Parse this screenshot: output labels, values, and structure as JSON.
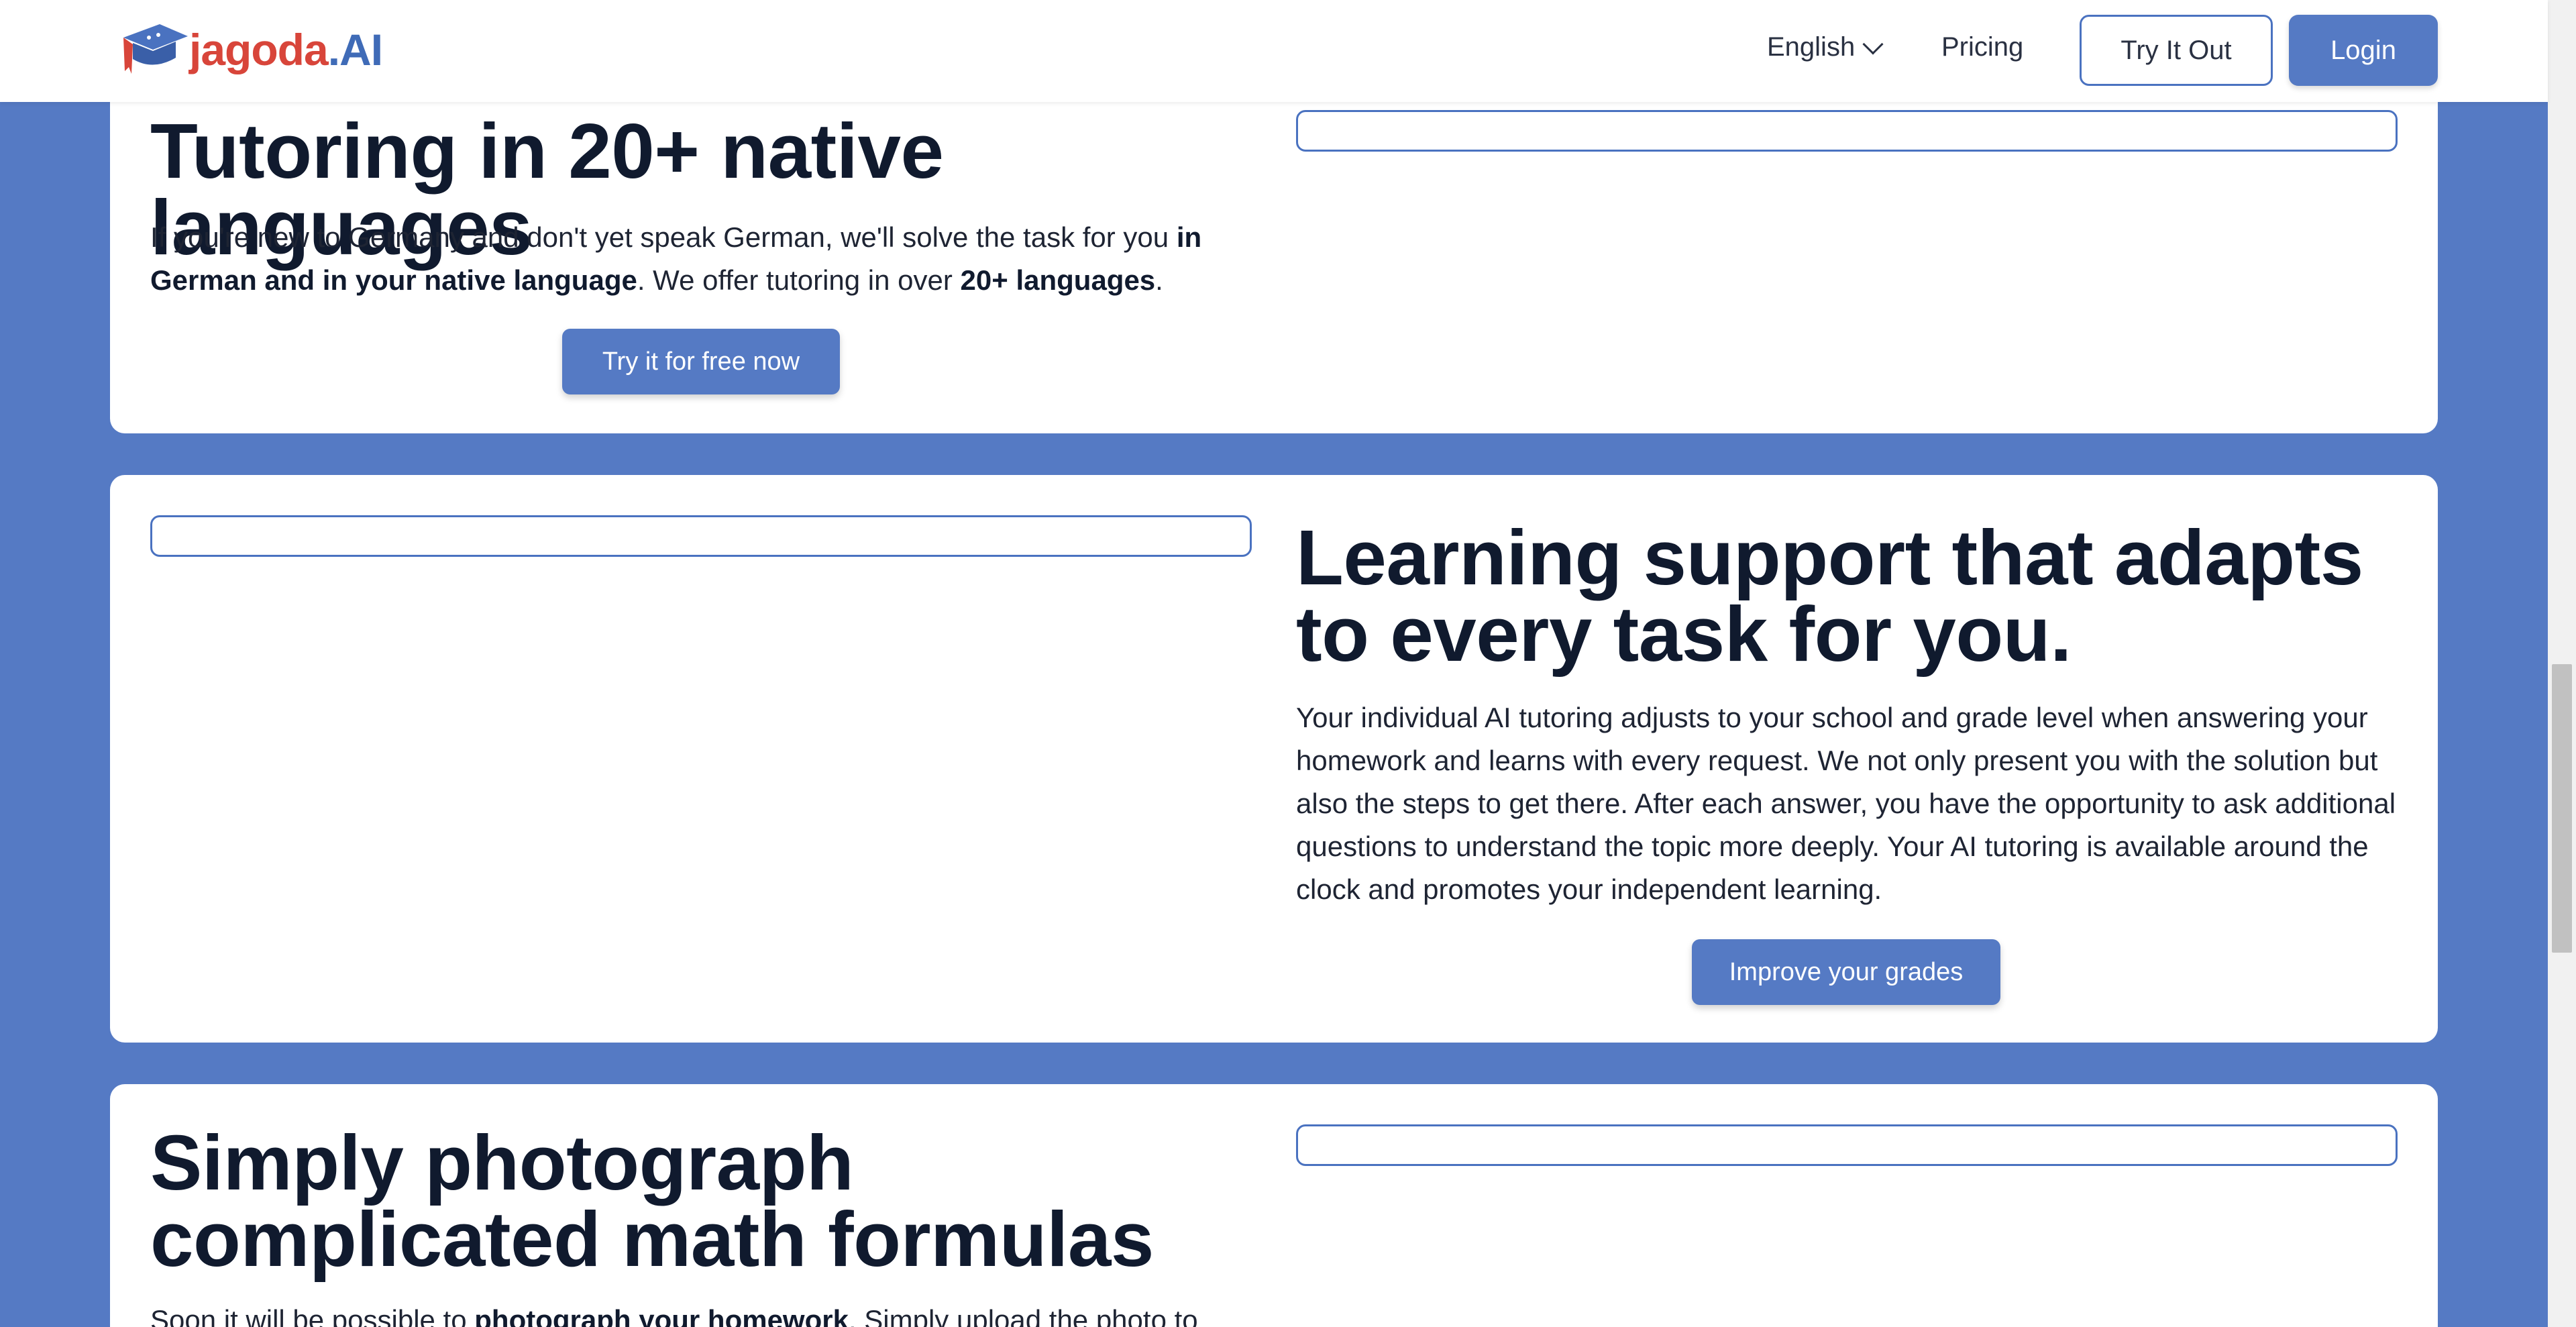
{
  "header": {
    "logo": {
      "brand_first": "jagoda",
      "brand_second": ".AI",
      "icon": "graduation-cap-logo-icon"
    },
    "language": {
      "label": "English",
      "icon": "chevron-down-icon"
    },
    "pricing_label": "Pricing",
    "try_label": "Try It Out",
    "login_label": "Login"
  },
  "sections": [
    {
      "title": "Tutoring in 20+ native languages",
      "text": [
        {
          "t": "If you're new to Germany and don't yet speak German, we'll solve the task for you ",
          "bold": false
        },
        {
          "t": "in German and in your native language",
          "bold": true
        },
        {
          "t": ". We offer tutoring in over ",
          "bold": false
        },
        {
          "t": "20+ languages",
          "bold": true
        },
        {
          "t": ".",
          "bold": false
        }
      ],
      "button_label": "Try it for free now"
    },
    {
      "title": "Learning support that adapts to every task for you.",
      "text": "Your individual AI tutoring adjusts to your school and grade level when answering your homework and learns with every request. We not only present you with the solution but also the steps to get there. After each answer, you have the opportunity to ask additional questions to understand the topic more deeply. Your AI tutoring is available around the clock and promotes your independent learning.",
      "button_label": "Improve your grades"
    },
    {
      "title": "Simply photograph complicated math formulas",
      "text": [
        {
          "t": "Soon it will be possible to ",
          "bold": false
        },
        {
          "t": "photograph your homework",
          "bold": true
        },
        {
          "t": ". Simply upload the photo to",
          "bold": false
        }
      ]
    }
  ],
  "colors": {
    "accent": "#557ac4",
    "brand_red": "#d8453a",
    "brand_blue": "#3f6bb7",
    "heading": "#101a2e"
  }
}
